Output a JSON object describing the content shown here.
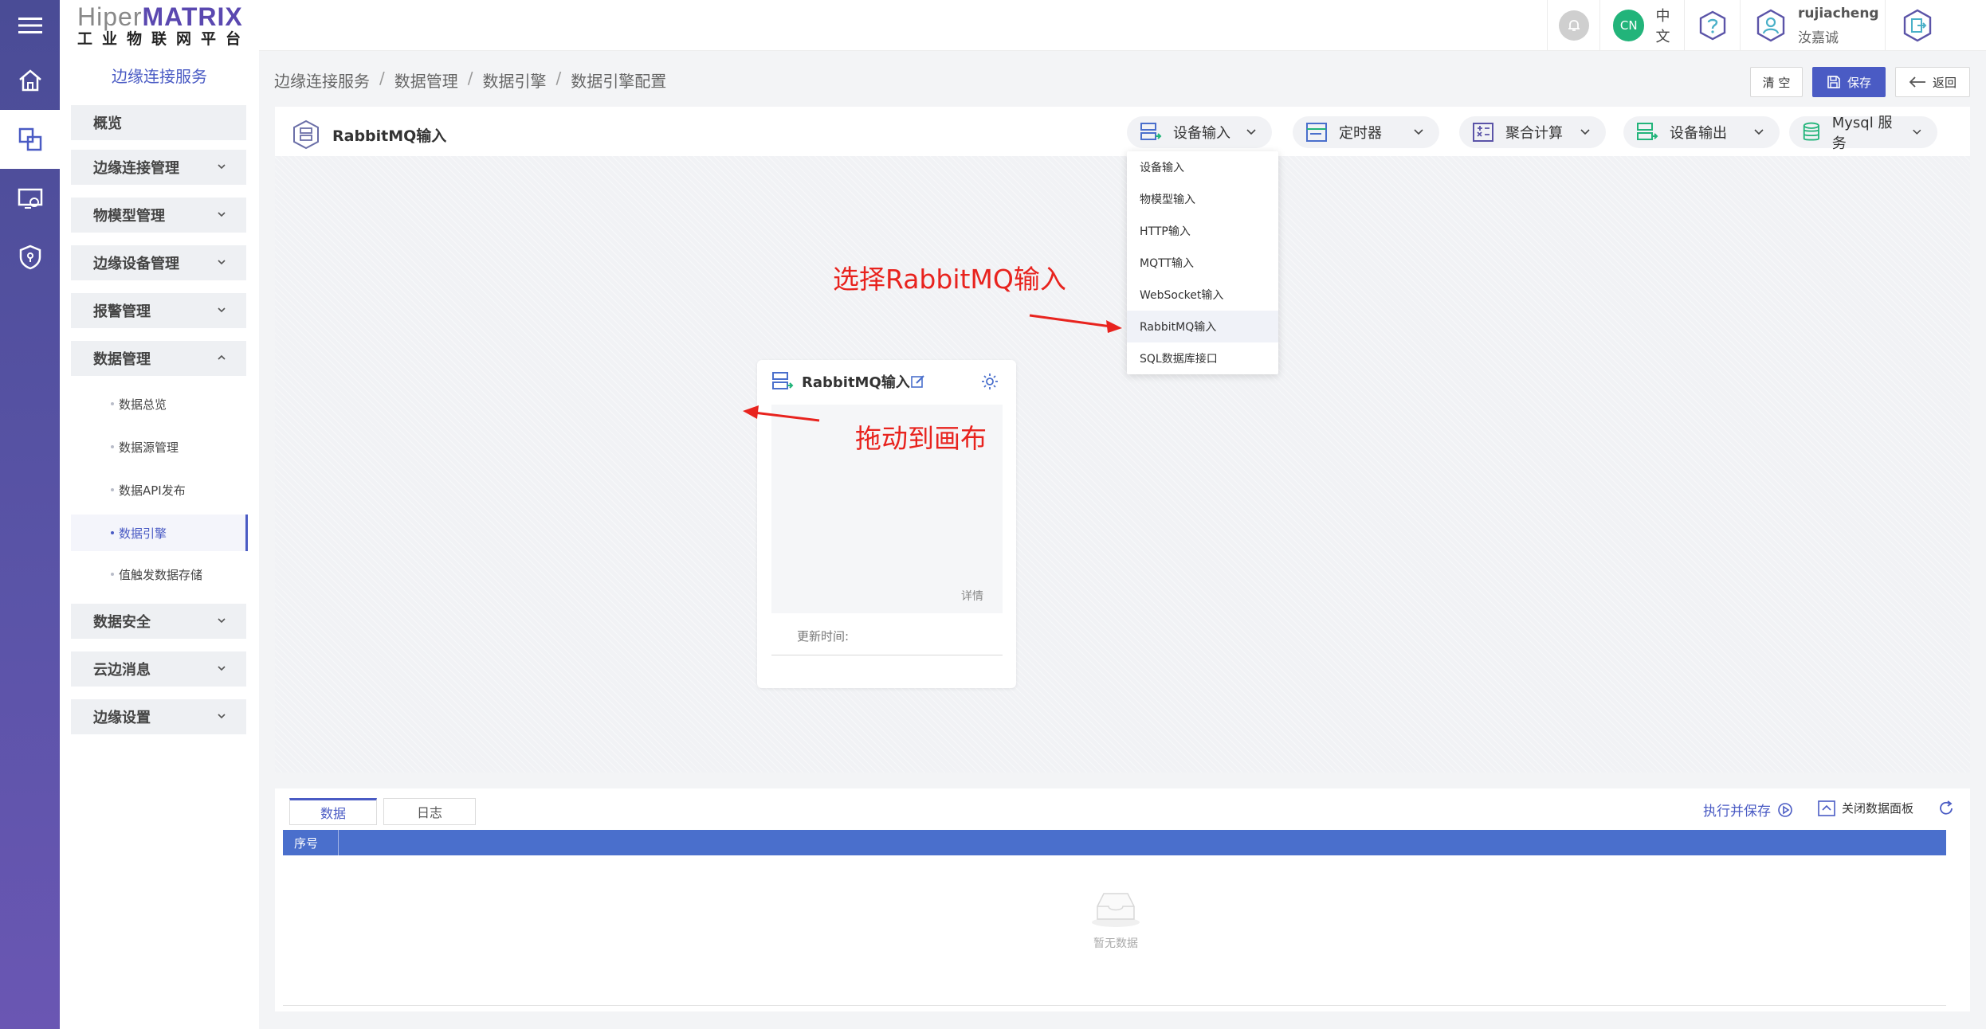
{
  "logo": {
    "brand_a": "Hiper",
    "brand_b": "MATRIX",
    "subtitle": "工业物联网平台"
  },
  "sidebar": {
    "title": "边缘连接服务",
    "groups": {
      "overview": "概览",
      "edge_conn": "边缘连接管理",
      "model": "物模型管理",
      "device": "边缘设备管理",
      "alarm": "报警管理",
      "data_mgmt": "数据管理",
      "data_security": "数据安全",
      "cloud_msg": "云边消息",
      "edge_settings": "边缘设置"
    },
    "data_sub": {
      "overview": "数据总览",
      "source": "数据源管理",
      "api": "数据API发布",
      "engine": "数据引擎",
      "trigger": "值触发数据存储"
    }
  },
  "topbar": {
    "lang_badge": "CN",
    "lang": "中文",
    "username": "rujiacheng",
    "display_name": "汝嘉诚"
  },
  "breadcrumb": [
    "边缘连接服务",
    "数据管理",
    "数据引擎",
    "数据引擎配置"
  ],
  "breadcrumb_sep": "/",
  "actions": {
    "clear": "清 空",
    "save": "保存",
    "back": "返回"
  },
  "editor": {
    "flow_title": "RabbitMQ输入",
    "tools": {
      "device_input": "设备输入",
      "timer": "定时器",
      "aggregate": "聚合计算",
      "device_output": "设备输出",
      "mysql": "Mysql 服务"
    },
    "dropdown": [
      "设备输入",
      "物模型输入",
      "HTTP输入",
      "MQTT输入",
      "WebSocket输入",
      "RabbitMQ输入",
      "SQL数据库接口"
    ],
    "node": {
      "title": "RabbitMQ输入",
      "detail": "详情",
      "update_time": "更新时间:"
    }
  },
  "annotations": {
    "select": "选择RabbitMQ输入",
    "drag": "拖动到画布"
  },
  "bottom": {
    "tabs": {
      "data": "数据",
      "log": "日志"
    },
    "execute_save": "执行并保存",
    "close_panel": "关闭数据面板",
    "col_seq": "序号",
    "empty": "暂无数据"
  },
  "colors": {
    "accent": "#4a5bc4",
    "rail": "#5b54a8",
    "annotation": "#e8231e",
    "table_header": "#4a6fcc"
  }
}
